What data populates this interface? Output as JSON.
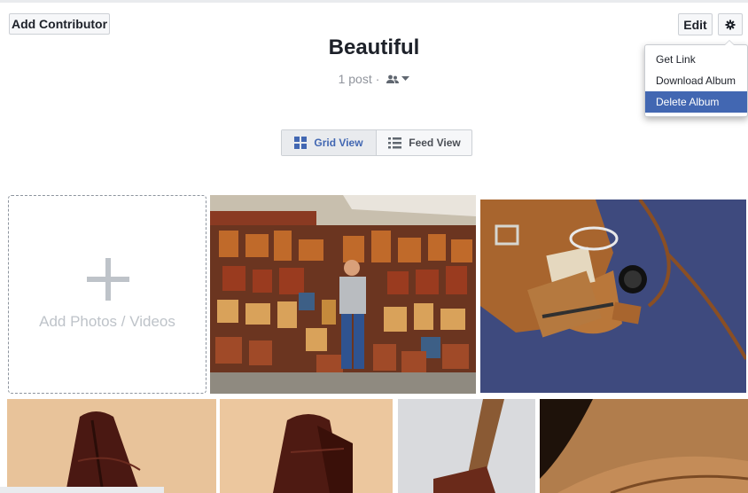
{
  "toolbar": {
    "add_contributor_label": "Add Contributor",
    "edit_label": "Edit",
    "gear_icon": "gear-icon"
  },
  "album": {
    "title": "Beautiful",
    "post_count": "1 post",
    "separator": "·",
    "privacy_icon": "friends-icon"
  },
  "menu": {
    "items": [
      {
        "label": "Get Link"
      },
      {
        "label": "Download Album"
      },
      {
        "label": "Delete Album"
      }
    ],
    "active_index": 2
  },
  "view_toggle": {
    "grid_label": "Grid View",
    "feed_label": "Feed View",
    "selected": "grid"
  },
  "add_tile": {
    "label": "Add Photos / Videos"
  },
  "colors": {
    "accent": "#4267b2",
    "muted_text": "#90949c"
  }
}
